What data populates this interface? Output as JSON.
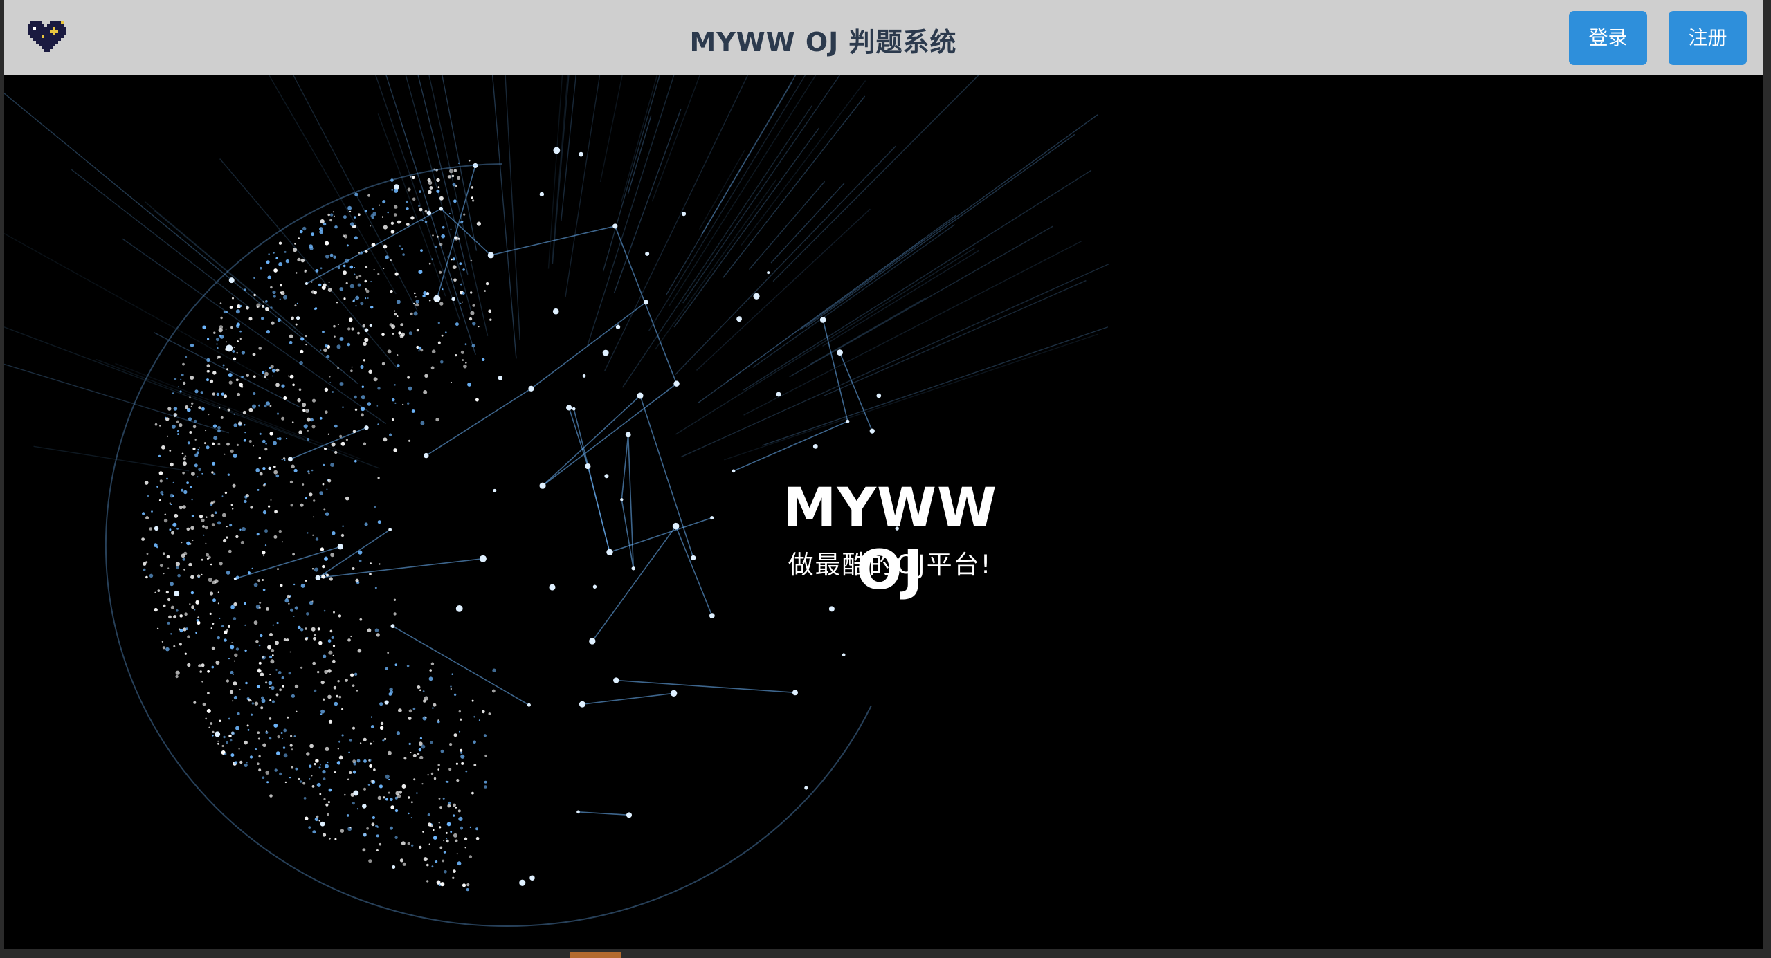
{
  "navbar": {
    "title": "MYWW OJ 判题系统",
    "login_label": "登录",
    "register_label": "注册",
    "logo_icon": "pixel-heart-icon"
  },
  "hero": {
    "title": "MYWW OJ",
    "subtitle": "做最酷的OJ平台!",
    "background": "globe-network-animation"
  },
  "colors": {
    "navbar_bg": "#cfcfcf",
    "title_text": "#2c3a4d",
    "button_bg": "#2e8fdb",
    "button_text": "#ffffff",
    "hero_bg": "#000000",
    "globe_accent": "#6fb8ff"
  }
}
